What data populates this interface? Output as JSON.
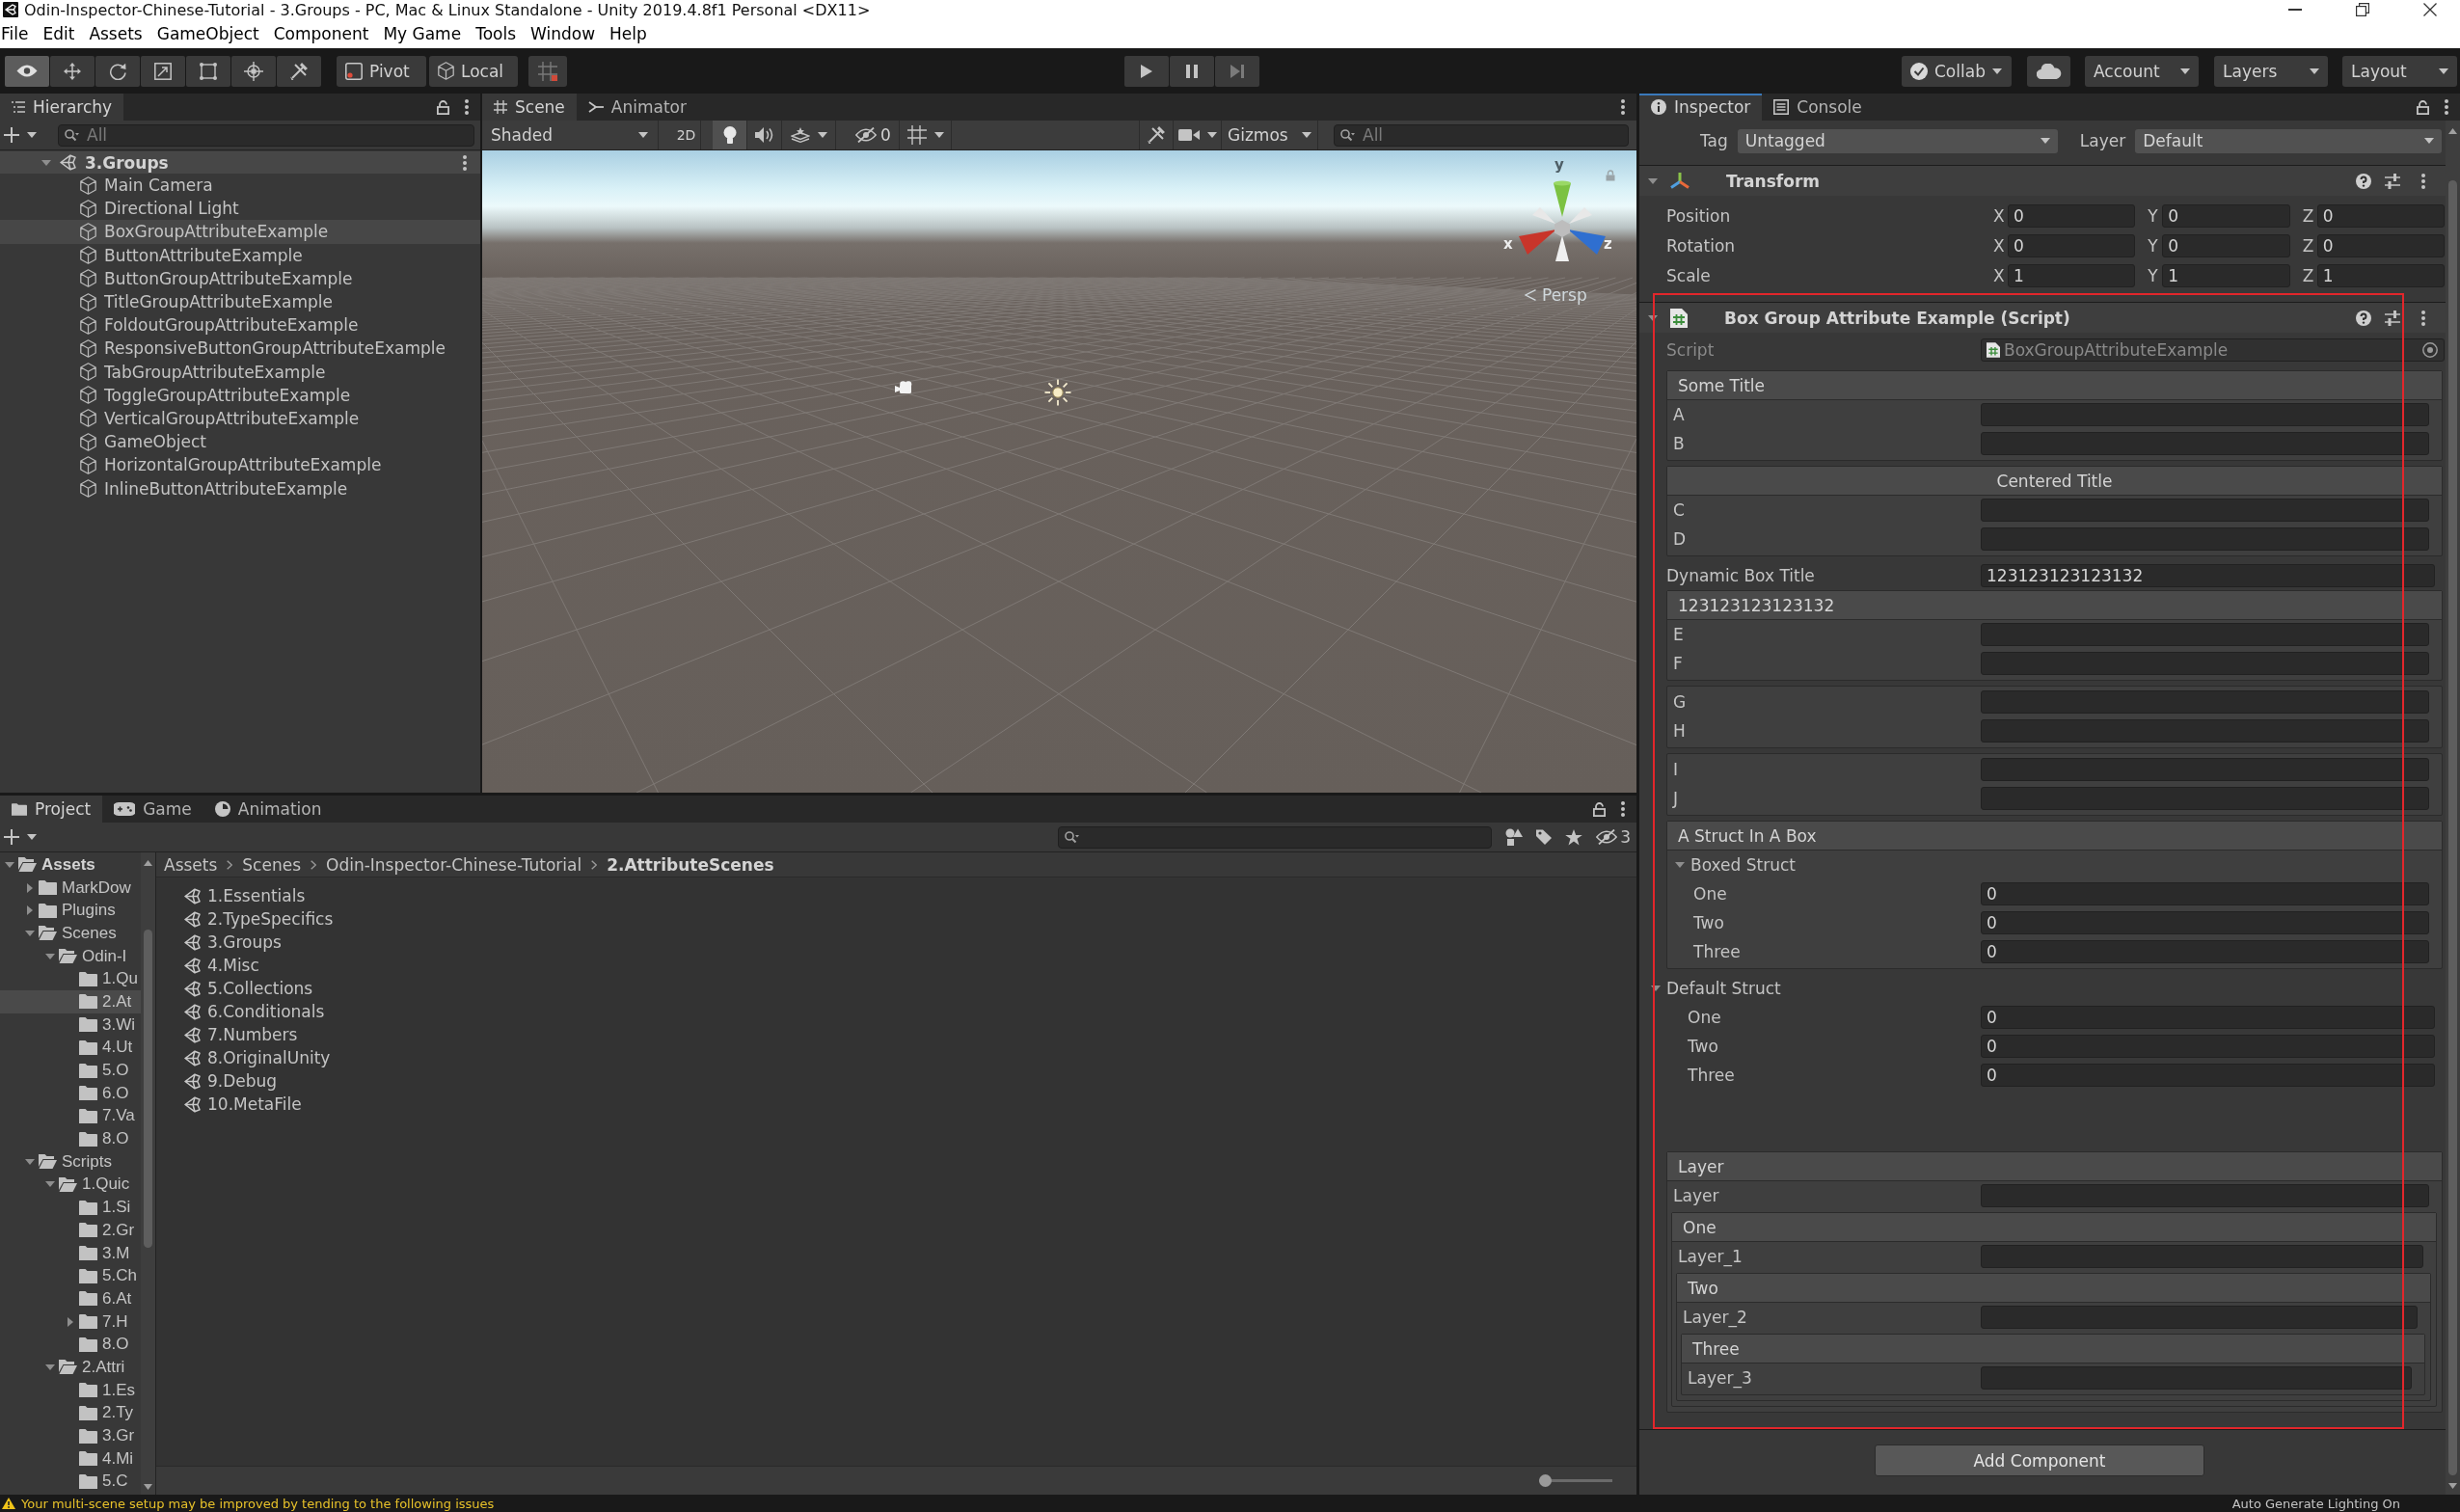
{
  "window": {
    "title": "Odin-Inspector-Chinese-Tutorial - 3.Groups - PC, Mac & Linux Standalone - Unity 2019.4.8f1 Personal <DX11>"
  },
  "menu": [
    "File",
    "Edit",
    "Assets",
    "GameObject",
    "Component",
    "My Game",
    "Tools",
    "Window",
    "Help"
  ],
  "toolbar": {
    "tools": [
      {
        "selected": true
      },
      {
        "selected": false
      },
      {
        "selected": false
      },
      {
        "selected": false
      },
      {
        "selected": false
      },
      {
        "selected": false
      },
      {
        "selected": false
      }
    ],
    "pivot": "Pivot",
    "space": "Local",
    "collab": "Collab",
    "account": "Account",
    "layers": "Layers",
    "layout": "Layout"
  },
  "hierarchy": {
    "focused": false,
    "tabs": [
      {
        "label": "Hierarchy",
        "selected": true
      }
    ],
    "search_placeholder": "All",
    "scene": {
      "name": "3.Groups",
      "expanded": true,
      "children": [
        {
          "name": "Main Camera",
          "selected": false
        },
        {
          "name": "Directional Light",
          "selected": false
        },
        {
          "name": "BoxGroupAttributeExample",
          "selected": true
        },
        {
          "name": "ButtonAttributeExample",
          "selected": false
        },
        {
          "name": "ButtonGroupAttributeExample",
          "selected": false
        },
        {
          "name": "TitleGroupAttributeExample",
          "selected": false
        },
        {
          "name": "FoldoutGroupAttributeExample",
          "selected": false
        },
        {
          "name": "ResponsiveButtonGroupAttributeExample",
          "selected": false
        },
        {
          "name": "TabGroupAttributeExample",
          "selected": false
        },
        {
          "name": "ToggleGroupAttributeExample",
          "selected": false
        },
        {
          "name": "VerticalGroupAttributeExample",
          "selected": false
        },
        {
          "name": "GameObject",
          "selected": false
        },
        {
          "name": "HorizontalGroupAttributeExample",
          "selected": false
        },
        {
          "name": "InlineButtonAttributeExample",
          "selected": false
        }
      ]
    }
  },
  "scene": {
    "focused": false,
    "tabs": [
      {
        "label": "Scene",
        "selected": true
      },
      {
        "label": "Animator",
        "selected": false
      }
    ],
    "shading": "Shaded",
    "mode_2d": "2D",
    "lighting": true,
    "hidden_count": "0",
    "gizmos": "Gizmos",
    "search_placeholder": "All",
    "axes": [
      {
        "label": "y"
      },
      {
        "label": "x"
      },
      {
        "label": "z"
      }
    ],
    "projection": "Persp"
  },
  "inspector": {
    "focused": true,
    "tabs": [
      {
        "label": "Inspector",
        "selected": true
      },
      {
        "label": "Console",
        "selected": false
      }
    ],
    "tag_label": "Tag",
    "tag": "Untagged",
    "layer_label": "Layer",
    "layer": "Default",
    "components": [
      {
        "kind": "transform",
        "title": "Transform",
        "expanded": true,
        "rows": [
          {
            "label": "Position",
            "values": [
              {
                "axis": "X",
                "value": "0"
              },
              {
                "axis": "Y",
                "value": "0"
              },
              {
                "axis": "Z",
                "value": "0"
              }
            ]
          },
          {
            "label": "Rotation",
            "values": [
              {
                "axis": "X",
                "value": "0"
              },
              {
                "axis": "Y",
                "value": "0"
              },
              {
                "axis": "Z",
                "value": "0"
              }
            ]
          },
          {
            "label": "Scale",
            "values": [
              {
                "axis": "X",
                "value": "1"
              },
              {
                "axis": "Y",
                "value": "1"
              },
              {
                "axis": "Z",
                "value": "1"
              }
            ]
          }
        ]
      },
      {
        "kind": "script",
        "title": "Box Group Attribute Example (Script)",
        "expanded": true,
        "highlighted": true,
        "script": {
          "label": "Script",
          "value": "BoxGroupAttributeExample",
          "disabled": true
        },
        "items": [
          {
            "kind": "box",
            "title": "Some Title",
            "centered": false,
            "items": [
              {
                "kind": "field",
                "label": "A"
              },
              {
                "kind": "field",
                "label": "B"
              }
            ]
          },
          {
            "kind": "box",
            "title": "Centered Title",
            "centered": true,
            "items": [
              {
                "kind": "field",
                "label": "C"
              },
              {
                "kind": "field",
                "label": "D"
              }
            ]
          },
          {
            "kind": "field",
            "label": "Dynamic Box Title",
            "value": "123123123123132"
          },
          {
            "kind": "box",
            "title": "123123123123132",
            "centered": false,
            "items": [
              {
                "kind": "field",
                "label": "E"
              },
              {
                "kind": "field",
                "label": "F"
              }
            ]
          },
          {
            "kind": "box",
            "items": [
              {
                "kind": "field",
                "label": "G"
              },
              {
                "kind": "field",
                "label": "H"
              }
            ]
          },
          {
            "kind": "box",
            "items": [
              {
                "kind": "field",
                "label": "I"
              },
              {
                "kind": "field",
                "label": "J"
              }
            ]
          },
          {
            "kind": "box",
            "title": "A Struct In A Box",
            "centered": false,
            "items": [
              {
                "kind": "foldout",
                "label": "Boxed Struct",
                "expanded": true,
                "items": [
                  {
                    "kind": "field",
                    "label": "One",
                    "value": "0"
                  },
                  {
                    "kind": "field",
                    "label": "Two",
                    "value": "0"
                  },
                  {
                    "kind": "field",
                    "label": "Three",
                    "value": "0"
                  }
                ]
              }
            ]
          },
          {
            "kind": "foldout",
            "label": "Default Struct",
            "expanded": true,
            "items": [
              {
                "kind": "field",
                "label": "One",
                "value": "0"
              },
              {
                "kind": "field",
                "label": "Two",
                "value": "0"
              },
              {
                "kind": "field",
                "label": "Three",
                "value": "0"
              }
            ]
          },
          {
            "kind": "space"
          },
          {
            "kind": "box",
            "title": "Layer",
            "centered": false,
            "items": [
              {
                "kind": "field",
                "label": "Layer"
              },
              {
                "kind": "box",
                "title": "One",
                "centered": false,
                "items": [
                  {
                    "kind": "field",
                    "label": "Layer_1"
                  },
                  {
                    "kind": "box",
                    "title": "Two",
                    "centered": false,
                    "items": [
                      {
                        "kind": "field",
                        "label": "Layer_2"
                      },
                      {
                        "kind": "box",
                        "title": "Three",
                        "centered": false,
                        "items": [
                          {
                            "kind": "field",
                            "label": "Layer_3"
                          }
                        ]
                      }
                    ]
                  }
                ]
              }
            ]
          }
        ]
      }
    ],
    "add_component": "Add Component"
  },
  "project": {
    "focused": false,
    "tabs": [
      {
        "label": "Project",
        "selected": true
      },
      {
        "label": "Game",
        "selected": false
      },
      {
        "label": "Animation",
        "selected": false
      }
    ],
    "hidden_count": "3",
    "tree": [
      {
        "name": "Assets",
        "expanded": true,
        "selected": false,
        "children": [
          {
            "name": "MarkDow",
            "expanded": false,
            "selected": false
          },
          {
            "name": "Plugins",
            "expanded": false,
            "selected": false
          },
          {
            "name": "Scenes",
            "expanded": true,
            "selected": false,
            "children": [
              {
                "name": "Odin-I",
                "expanded": true,
                "selected": false,
                "children": [
                  {
                    "name": "1.Qu",
                    "selected": false
                  },
                  {
                    "name": "2.At",
                    "selected": true
                  },
                  {
                    "name": "3.Wi",
                    "selected": false
                  },
                  {
                    "name": "4.Ut",
                    "selected": false
                  },
                  {
                    "name": "5.O",
                    "selected": false
                  },
                  {
                    "name": "6.O",
                    "selected": false
                  },
                  {
                    "name": "7.Va",
                    "selected": false
                  },
                  {
                    "name": "8.O",
                    "selected": false
                  }
                ]
              }
            ]
          },
          {
            "name": "Scripts",
            "expanded": true,
            "selected": false,
            "children": [
              {
                "name": "1.Quic",
                "expanded": true,
                "selected": false,
                "children": [
                  {
                    "name": "1.Si",
                    "selected": false
                  },
                  {
                    "name": "2.Gr",
                    "selected": false
                  },
                  {
                    "name": "3.M",
                    "selected": false
                  },
                  {
                    "name": "5.Ch",
                    "selected": false
                  },
                  {
                    "name": "6.At",
                    "selected": false
                  },
                  {
                    "name": "7.H",
                    "expanded": false,
                    "selected": false
                  },
                  {
                    "name": "8.O",
                    "selected": false
                  }
                ]
              },
              {
                "name": "2.Attri",
                "expanded": true,
                "selected": false,
                "children": [
                  {
                    "name": "1.Es",
                    "selected": false
                  },
                  {
                    "name": "2.Ty",
                    "selected": false
                  },
                  {
                    "name": "3.Gr",
                    "selected": false
                  },
                  {
                    "name": "4.Mi",
                    "selected": false
                  },
                  {
                    "name": "5.C",
                    "selected": false
                  }
                ]
              }
            ]
          }
        ]
      }
    ],
    "breadcrumb": [
      "Assets",
      "Scenes",
      "Odin-Inspector-Chinese-Tutorial",
      "2.AttributeScenes"
    ],
    "files": [
      "1.Essentials",
      "2.TypeSpecifics",
      "3.Groups",
      "4.Misc",
      "5.Collections",
      "6.Conditionals",
      "7.Numbers",
      "8.OriginalUnity",
      "9.Debug",
      "10.MetaFile"
    ],
    "icon_size": {
      "level": 0
    }
  },
  "status_bar": {
    "message": "Your multi-scene setup may be improved by tending to the following issues",
    "lighting": "Auto Generate Lighting On"
  }
}
